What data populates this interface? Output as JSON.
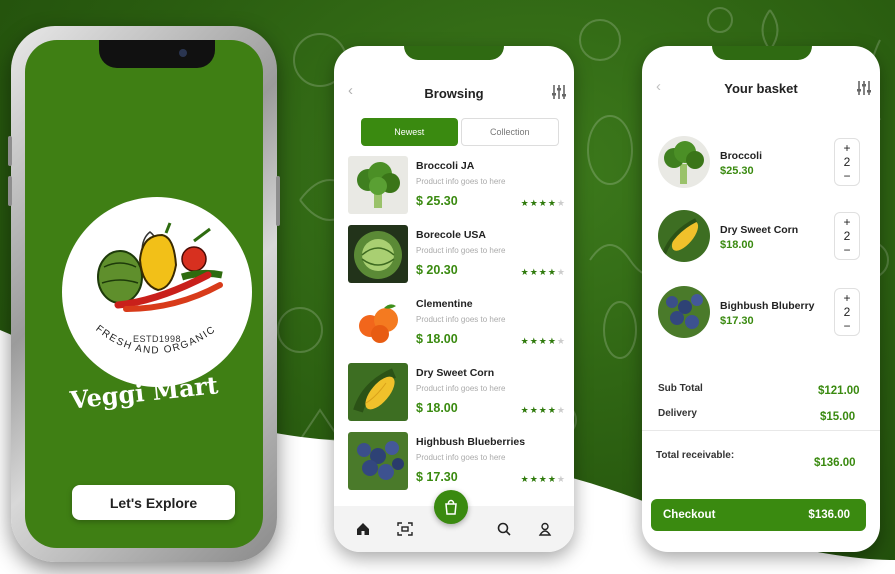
{
  "splash": {
    "logo": {
      "estd": "ESTD1998",
      "tagline": "FRESH AND ORGANIC"
    },
    "brand": "Veggi Mart",
    "explore_label": "Let's Explore"
  },
  "browsing": {
    "title": "Browsing",
    "tabs": [
      {
        "label": "Newest",
        "active": true
      },
      {
        "label": "Collection",
        "active": false
      }
    ],
    "products": [
      {
        "name": "Broccoli JA",
        "desc": "Product info goes to here",
        "price": "$ 25.30",
        "rating": 4,
        "image": "broccoli"
      },
      {
        "name": "Borecole USA",
        "desc": "Product info goes to here",
        "price": "$ 20.30",
        "rating": 4,
        "image": "cabbage"
      },
      {
        "name": "Clementine",
        "desc": "Product info goes to here",
        "price": "$ 18.00",
        "rating": 4,
        "image": "clementine"
      },
      {
        "name": "Dry Sweet Corn",
        "desc": "Product info goes to here",
        "price": "$ 18.00",
        "rating": 4,
        "image": "corn"
      },
      {
        "name": "Highbush Blueberries",
        "desc": "Product info goes to here",
        "price": "$ 17.30",
        "rating": 4,
        "image": "blueberries"
      }
    ],
    "tabbar": [
      "home-icon",
      "scan-icon",
      "cart-icon",
      "search-icon",
      "profile-icon"
    ]
  },
  "basket": {
    "title": "Your basket",
    "items": [
      {
        "name": "Broccoli",
        "price": "$25.30",
        "qty": "2",
        "image": "broccoli"
      },
      {
        "name": "Dry Sweet Corn",
        "price": "$18.00",
        "qty": "2",
        "image": "corn"
      },
      {
        "name": "Bighbush Bluberry",
        "price": "$17.30",
        "qty": "2",
        "image": "blueberries"
      }
    ],
    "subtotal_label": "Sub Total",
    "subtotal_value": "$121.00",
    "delivery_label": "Delivery",
    "delivery_value": "$15.00",
    "receivable_label": "Total receivable:",
    "receivable_value": "$136.00",
    "checkout_label": "Checkout",
    "checkout_value": "$136.00"
  },
  "colors": {
    "brand_green": "#3a8a10",
    "background_green": "#2a5d10",
    "splash_green": "#3f7f14"
  }
}
